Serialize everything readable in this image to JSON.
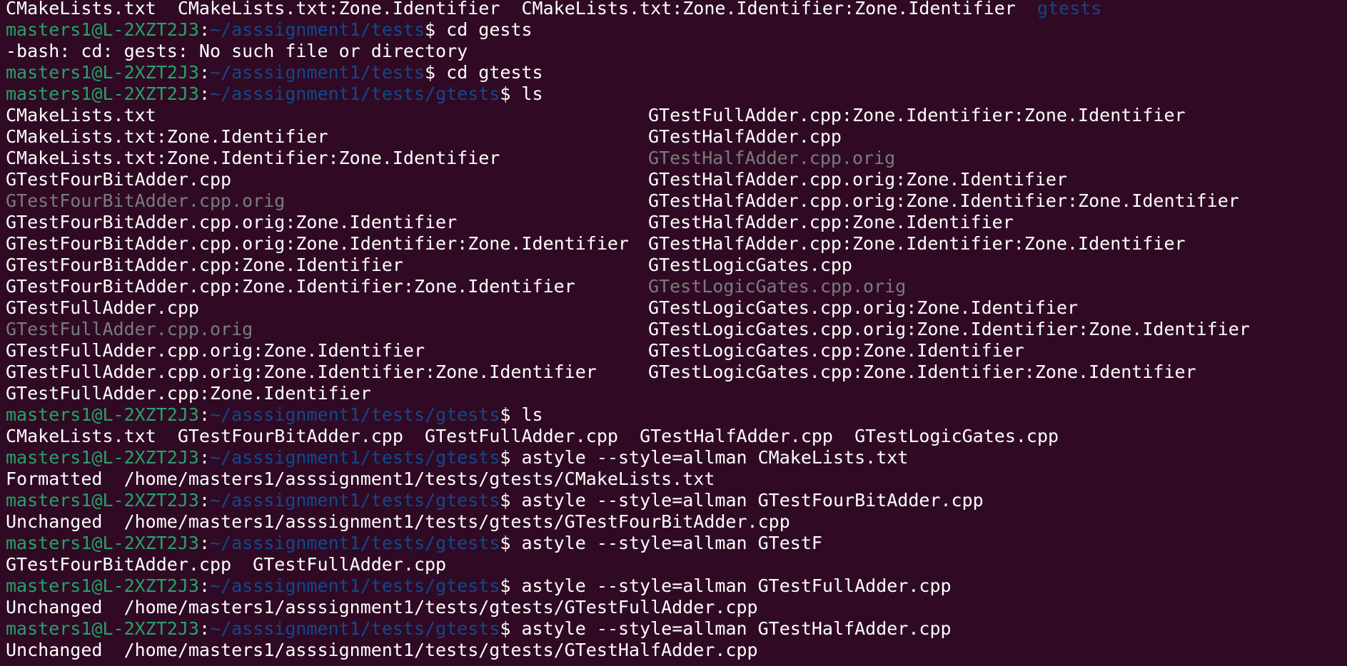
{
  "colors": {
    "background": "#300a24",
    "user_host": "#26a269",
    "path": "#12488b",
    "directory": "#12488b",
    "backup_file": "#7b7b7b",
    "text": "#ffffff"
  },
  "first_line": [
    "CMakeLists.txt",
    "CMakeLists.txt:Zone.Identifier",
    "CMakeLists.txt:Zone.Identifier:Zone.Identifier"
  ],
  "first_line_dir": "gtests",
  "prompt": {
    "user_host": "masters1@L-2XZT2J3",
    "path_tests": "~/asssignment1/tests",
    "path_gtests": "~/asssignment1/tests/gtests"
  },
  "cmds": {
    "c1": "cd gests",
    "c2": "cd gtests",
    "c3": "ls",
    "c4": "ls",
    "c5": "astyle --style=allman CMakeLists.txt",
    "c6": "astyle --style=allman GTestFourBitAdder.cpp",
    "c7": "astyle --style=allman GTestF",
    "c8": "astyle --style=allman GTestFullAdder.cpp",
    "c9": "astyle --style=allman GTestHalfAdder.cpp"
  },
  "error_line": "-bash: cd: gests: No such file or directory",
  "ls_left": [
    "CMakeLists.txt",
    "CMakeLists.txt:Zone.Identifier",
    "CMakeLists.txt:Zone.Identifier:Zone.Identifier",
    "GTestFourBitAdder.cpp",
    "GTestFourBitAdder.cpp.orig",
    "GTestFourBitAdder.cpp.orig:Zone.Identifier",
    "GTestFourBitAdder.cpp.orig:Zone.Identifier:Zone.Identifier",
    "GTestFourBitAdder.cpp:Zone.Identifier",
    "GTestFourBitAdder.cpp:Zone.Identifier:Zone.Identifier",
    "GTestFullAdder.cpp",
    "GTestFullAdder.cpp.orig",
    "GTestFullAdder.cpp.orig:Zone.Identifier",
    "GTestFullAdder.cpp.orig:Zone.Identifier:Zone.Identifier",
    "GTestFullAdder.cpp:Zone.Identifier"
  ],
  "ls_right": [
    "GTestFullAdder.cpp:Zone.Identifier:Zone.Identifier",
    "GTestHalfAdder.cpp",
    "GTestHalfAdder.cpp.orig",
    "GTestHalfAdder.cpp.orig:Zone.Identifier",
    "GTestHalfAdder.cpp.orig:Zone.Identifier:Zone.Identifier",
    "GTestHalfAdder.cpp:Zone.Identifier",
    "GTestHalfAdder.cpp:Zone.Identifier:Zone.Identifier",
    "GTestLogicGates.cpp",
    "GTestLogicGates.cpp.orig",
    "GTestLogicGates.cpp.orig:Zone.Identifier",
    "GTestLogicGates.cpp.orig:Zone.Identifier:Zone.Identifier",
    "GTestLogicGates.cpp:Zone.Identifier",
    "GTestLogicGates.cpp:Zone.Identifier:Zone.Identifier"
  ],
  "ls2": [
    "CMakeLists.txt",
    "GTestFourBitAdder.cpp",
    "GTestFullAdder.cpp",
    "GTestHalfAdder.cpp",
    "GTestLogicGates.cpp"
  ],
  "out": {
    "o5": "Formatted  /home/masters1/asssignment1/tests/gtests/CMakeLists.txt",
    "o6": "Unchanged  /home/masters1/asssignment1/tests/gtests/GTestFourBitAdder.cpp",
    "o7": "GTestFourBitAdder.cpp  GTestFullAdder.cpp",
    "o8": "Unchanged  /home/masters1/asssignment1/tests/gtests/GTestFullAdder.cpp",
    "o9": "Unchanged  /home/masters1/asssignment1/tests/gtests/GTestHalfAdder.cpp"
  },
  "dollar": "$ ",
  "colon": ":"
}
